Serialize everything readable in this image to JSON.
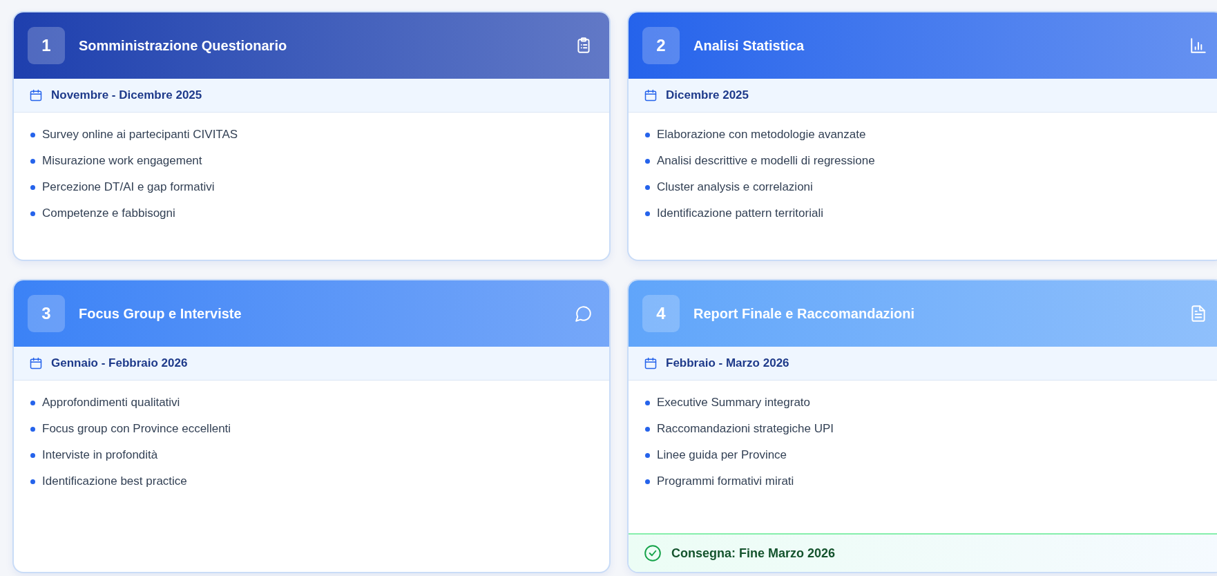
{
  "phases": [
    {
      "number": "1",
      "title": "Somministrazione Questionario",
      "color": "#1e3fae",
      "period": "Novembre - Dicembre 2025",
      "items": [
        "Survey online ai partecipanti CIVITAS",
        "Misurazione work engagement",
        "Percezione DT/AI e gap formativi",
        "Competenze e fabbisogni"
      ]
    },
    {
      "number": "2",
      "title": "Analisi Statistica",
      "color": "#2563eb",
      "period": "Dicembre 2025",
      "items": [
        "Elaborazione con metodologie avanzate",
        "Analisi descrittive e modelli di regressione",
        "Cluster analysis e correlazioni",
        "Identificazione pattern territoriali"
      ]
    },
    {
      "number": "3",
      "title": "Focus Group e Interviste",
      "color": "#3b82f6",
      "period": "Gennaio - Febbraio 2026",
      "items": [
        "Approfondimenti qualitativi",
        "Focus group con Province eccellenti",
        "Interviste in profondità",
        "Identificazione best practice"
      ]
    },
    {
      "number": "4",
      "title": "Report Finale e Raccomandazioni",
      "color": "#60a5fa",
      "period": "Febbraio - Marzo 2026",
      "items": [
        "Executive Summary integrato",
        "Raccomandazioni strategiche UPI",
        "Linee guida per Province",
        "Programmi formativi mirati"
      ],
      "delivery": "Consegna: Fine Marzo 2026"
    }
  ]
}
